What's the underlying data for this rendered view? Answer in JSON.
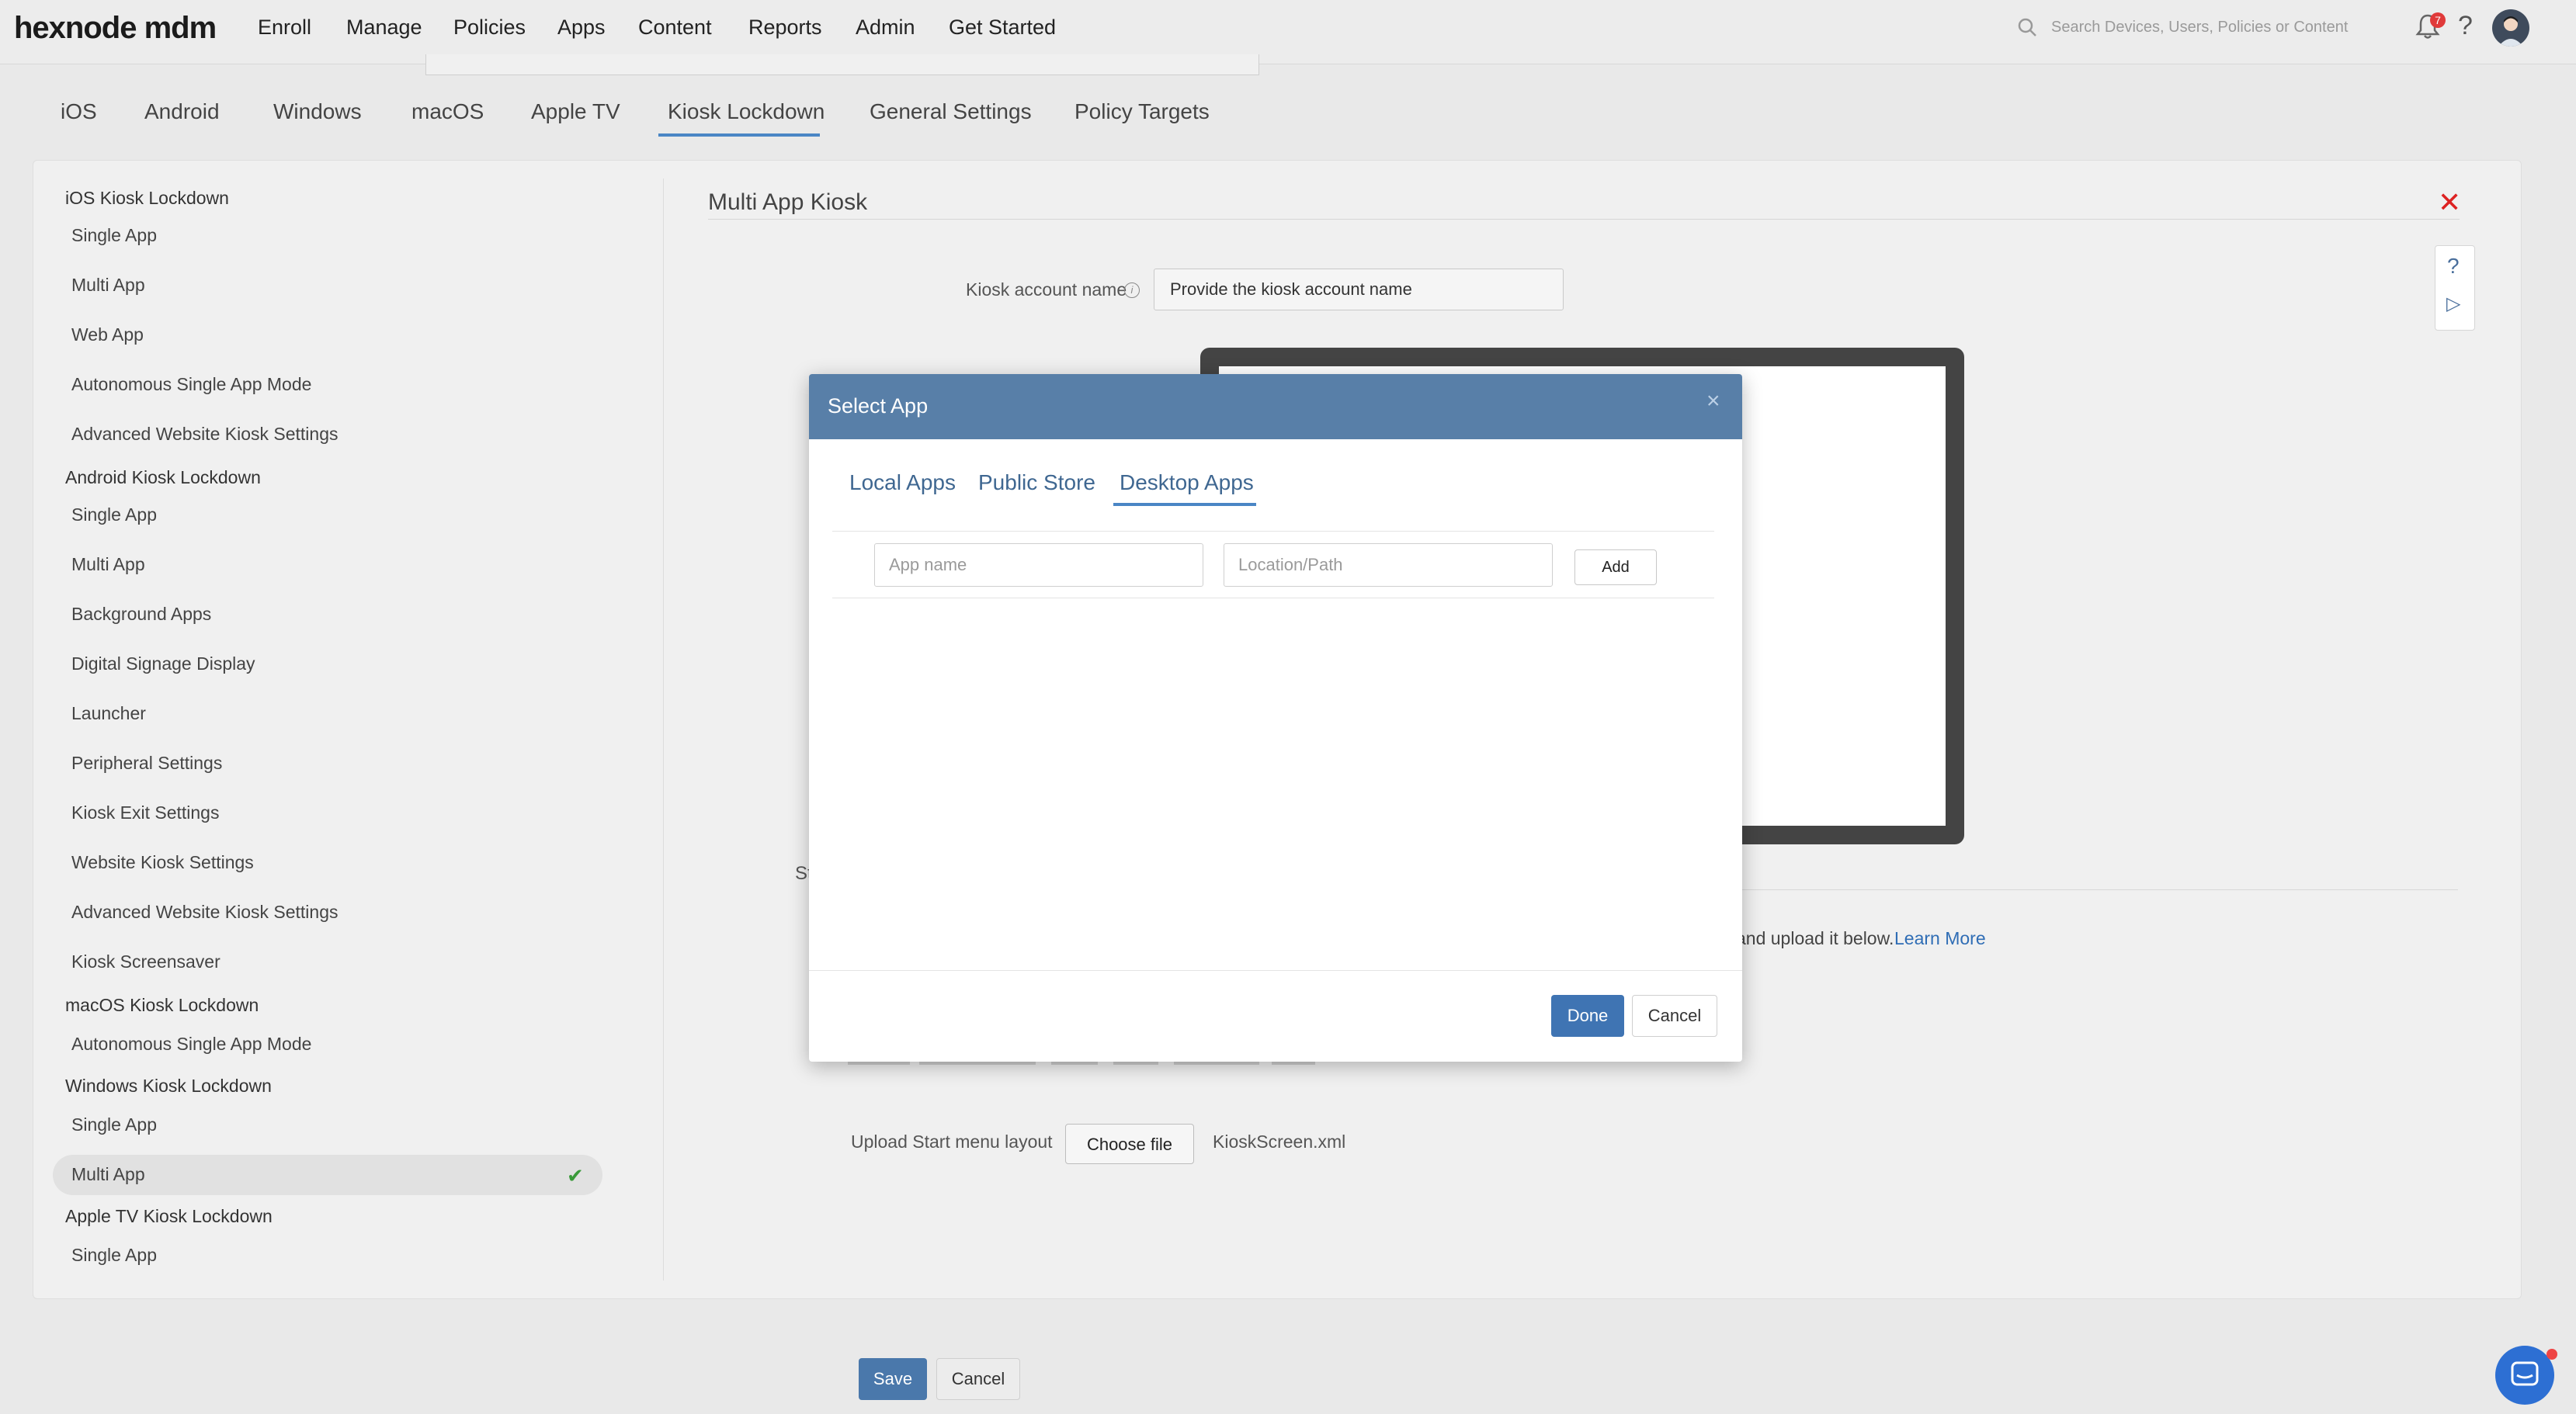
{
  "app": {
    "logo": "hexnode mdm"
  },
  "topnav": {
    "items": [
      "Enroll",
      "Manage",
      "Policies",
      "Apps",
      "Content",
      "Reports",
      "Admin",
      "Get Started"
    ],
    "active": "Policies",
    "search_placeholder": "Search Devices, Users, Policies or Content",
    "notification_count": "7"
  },
  "platform_tabs": {
    "items": [
      "iOS",
      "Android",
      "Windows",
      "macOS",
      "Apple TV",
      "Kiosk Lockdown",
      "General Settings",
      "Policy Targets"
    ],
    "active": "Kiosk Lockdown"
  },
  "sidebar": {
    "groups": [
      {
        "heading": "iOS Kiosk Lockdown",
        "items": [
          "Single App",
          "Multi App",
          "Web App",
          "Autonomous Single App Mode",
          "Advanced Website Kiosk Settings"
        ]
      },
      {
        "heading": "Android Kiosk Lockdown",
        "items": [
          "Single App",
          "Multi App",
          "Background Apps",
          "Digital Signage Display",
          "Launcher",
          "Peripheral Settings",
          "Kiosk Exit Settings",
          "Website Kiosk Settings",
          "Advanced Website Kiosk Settings",
          "Kiosk Screensaver"
        ]
      },
      {
        "heading": "macOS Kiosk Lockdown",
        "items": [
          "Autonomous Single App Mode"
        ]
      },
      {
        "heading": "Windows Kiosk Lockdown",
        "items": [
          "Single App",
          "Multi App"
        ]
      },
      {
        "heading": "Apple TV Kiosk Lockdown",
        "items": [
          "Single App"
        ]
      }
    ],
    "active_item": "Multi App"
  },
  "content": {
    "title": "Multi App Kiosk",
    "kiosk_account_label": "Kiosk account name",
    "kiosk_account_value": "Provide the kiosk account name",
    "fragment_st": "St",
    "hint_text": "and upload it below.",
    "learn_more": "Learn More",
    "upload_label": "Upload Start menu layout",
    "choose_file": "Choose file",
    "file_name": "KioskScreen.xml"
  },
  "modal": {
    "title": "Select App",
    "tabs": [
      "Local Apps",
      "Public Store",
      "Desktop Apps"
    ],
    "active_tab": "Desktop Apps",
    "app_name_placeholder": "App name",
    "location_placeholder": "Location/Path",
    "add_label": "Add",
    "done_label": "Done",
    "cancel_label": "Cancel"
  },
  "footer": {
    "save_label": "Save",
    "cancel_label": "Cancel"
  },
  "colors": {
    "accent": "#4a86c5",
    "modal_header": "#587fa8",
    "primary_button": "#3f74b3",
    "close_red": "#dd2222"
  }
}
